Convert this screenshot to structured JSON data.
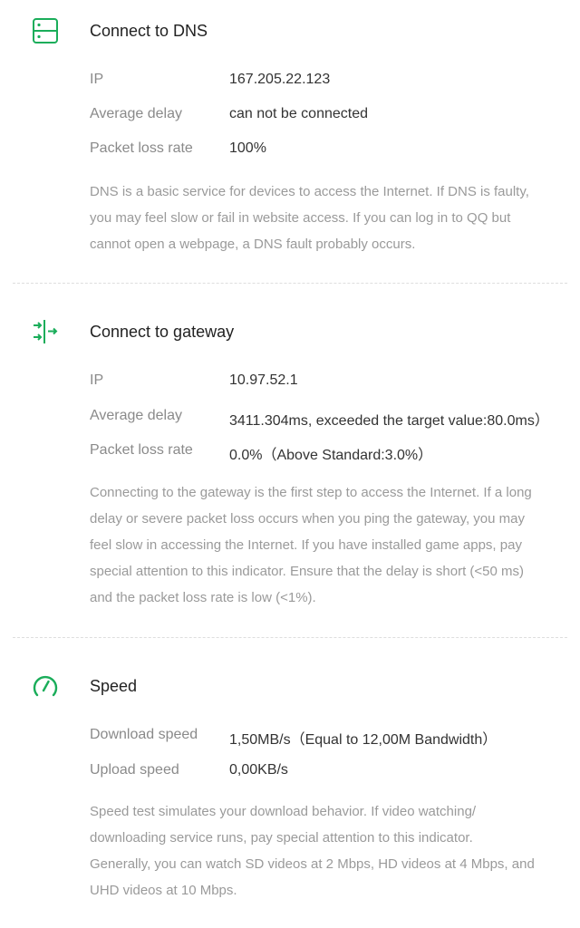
{
  "colors": {
    "accent": "#1aad5a",
    "title": "#222222",
    "label": "#8a8a8a",
    "value": "#333333",
    "description": "#9a9a9a",
    "divider": "#dedede"
  },
  "dns": {
    "icon": "server-icon",
    "title": "Connect to DNS",
    "rows": [
      {
        "label": "IP",
        "value": "167.205.22.123"
      },
      {
        "label": "Average delay",
        "value": "can not be connected"
      },
      {
        "label": "Packet loss rate",
        "value": "100%"
      }
    ],
    "description_lines": [
      "DNS is a basic service for devices to access the Internet. If DNS is faulty,",
      "you may feel slow or fail in website access. If you can log in to QQ but",
      "cannot open a webpage, a DNS fault probably occurs."
    ]
  },
  "gateway": {
    "icon": "gateway-arrows-icon",
    "title": "Connect to gateway",
    "rows": [
      {
        "label": "IP",
        "value": "10.97.52.1"
      },
      {
        "label": "Average delay",
        "value": "3411.304ms, exceeded the target value:80.0ms）"
      },
      {
        "label": "Packet loss rate",
        "value": "0.0%（Above Standard:3.0%）"
      }
    ],
    "description_lines": [
      "Connecting to the gateway is the first step to access the Internet. If a long",
      "delay or severe packet loss occurs when you ping the gateway, you may",
      "feel slow in accessing the Internet. If you have installed game apps, pay",
      "special attention to this indicator. Ensure that the delay is short (<50 ms)",
      "and the packet loss rate is low (<1%)."
    ]
  },
  "speed": {
    "icon": "speedometer-icon",
    "title": "Speed",
    "rows": [
      {
        "label": "Download speed",
        "value": "1,50MB/s（Equal to 12,00M Bandwidth）"
      },
      {
        "label": "Upload speed",
        "value": "0,00KB/s"
      }
    ],
    "description_lines": [
      "Speed test simulates your download behavior. If video watching/",
      "downloading service runs, pay special attention to this indicator.",
      "Generally, you can watch SD videos at 2 Mbps, HD videos at 4 Mbps, and",
      "UHD videos at 10 Mbps."
    ]
  }
}
